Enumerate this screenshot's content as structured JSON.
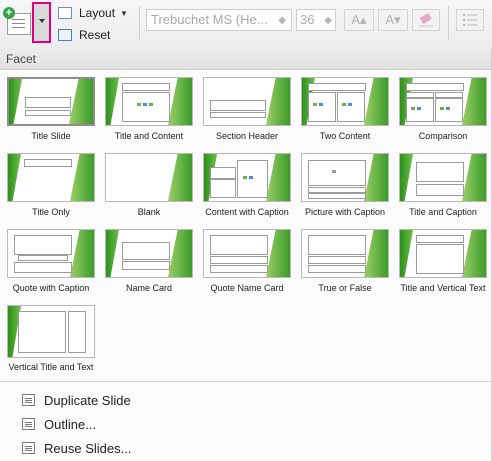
{
  "toolbar": {
    "layout_label": "Layout",
    "reset_label": "Reset",
    "font_name": "Trebuchet MS (He...",
    "font_size": "36",
    "increase_font_label": "A▴",
    "decrease_font_label": "A▾"
  },
  "gallery": {
    "theme_name": "Facet",
    "layouts": [
      {
        "label": "Title Slide"
      },
      {
        "label": "Title and Content"
      },
      {
        "label": "Section Header"
      },
      {
        "label": "Two Content"
      },
      {
        "label": "Comparison"
      },
      {
        "label": "Title Only"
      },
      {
        "label": "Blank"
      },
      {
        "label": "Content with Caption"
      },
      {
        "label": "Picture with Caption"
      },
      {
        "label": "Title and Caption"
      },
      {
        "label": "Quote with Caption"
      },
      {
        "label": "Name Card"
      },
      {
        "label": "Quote Name Card"
      },
      {
        "label": "True or False"
      },
      {
        "label": "Title and Vertical Text"
      },
      {
        "label": "Vertical Title and Text"
      }
    ]
  },
  "menu": {
    "duplicate_slide": "Duplicate Slide",
    "outline": "Outline...",
    "reuse_slides": "Reuse Slides..."
  },
  "colors": {
    "highlight": "#e3007f",
    "theme_green": "#3c9a2a"
  }
}
